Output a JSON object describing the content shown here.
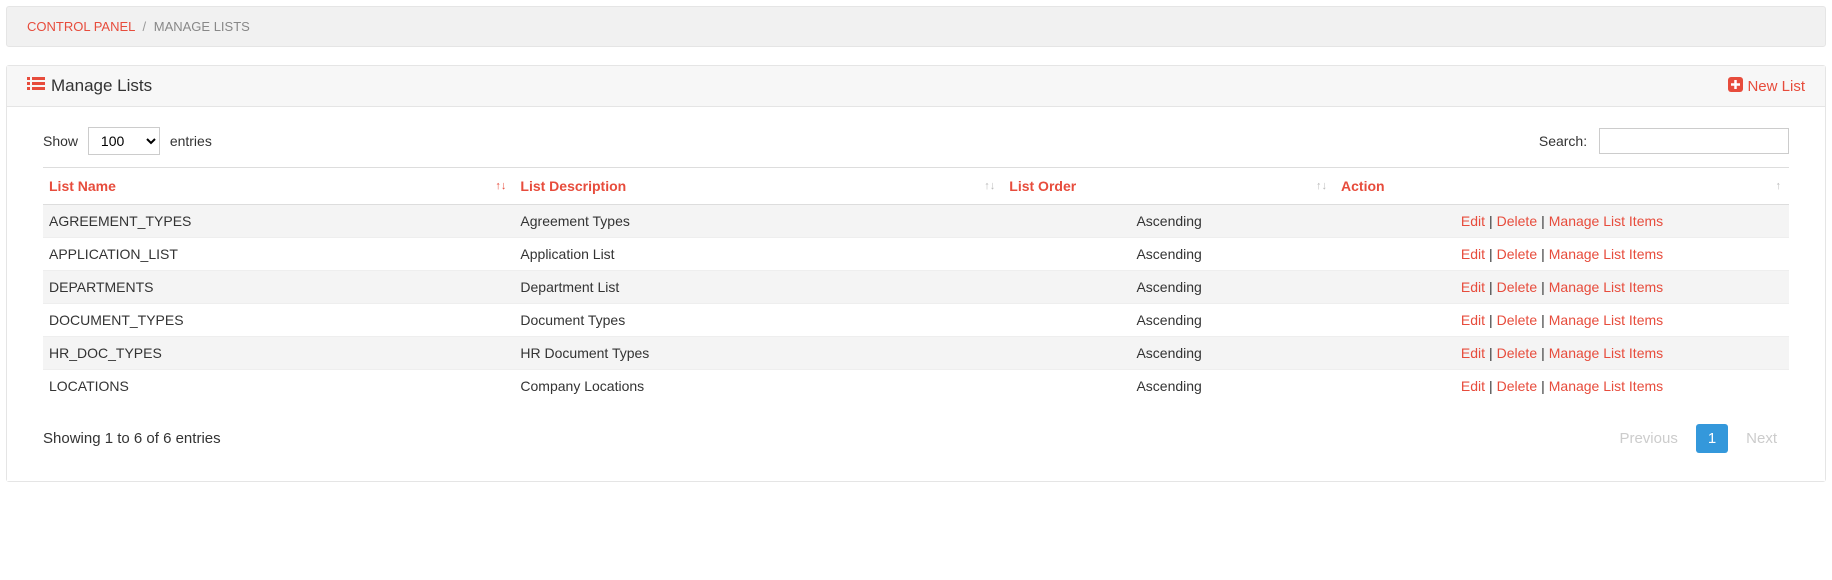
{
  "breadcrumb": {
    "root": "CONTROL PANEL",
    "current": "MANAGE LISTS"
  },
  "panel": {
    "title": "Manage Lists",
    "new_list": "New List"
  },
  "datatable": {
    "show_label_pre": "Show",
    "show_label_post": "entries",
    "length_value": "100",
    "search_label": "Search:",
    "search_value": "",
    "columns": {
      "name": "List Name",
      "description": "List Description",
      "order": "List Order",
      "action": "Action"
    },
    "rows": [
      {
        "name": "AGREEMENT_TYPES",
        "description": "Agreement Types",
        "order": "Ascending"
      },
      {
        "name": "APPLICATION_LIST",
        "description": "Application List",
        "order": "Ascending"
      },
      {
        "name": "DEPARTMENTS",
        "description": "Department List",
        "order": "Ascending"
      },
      {
        "name": "DOCUMENT_TYPES",
        "description": "Document Types",
        "order": "Ascending"
      },
      {
        "name": "HR_DOC_TYPES",
        "description": "HR Document Types",
        "order": "Ascending"
      },
      {
        "name": "LOCATIONS",
        "description": "Company Locations",
        "order": "Ascending"
      }
    ],
    "actions": {
      "edit": "Edit",
      "delete": "Delete",
      "manage": "Manage List Items"
    },
    "info": "Showing 1 to 6 of 6 entries",
    "pagination": {
      "previous": "Previous",
      "next": "Next",
      "current": "1"
    }
  },
  "colors": {
    "accent": "#e74c3c",
    "primary": "#3498db"
  }
}
